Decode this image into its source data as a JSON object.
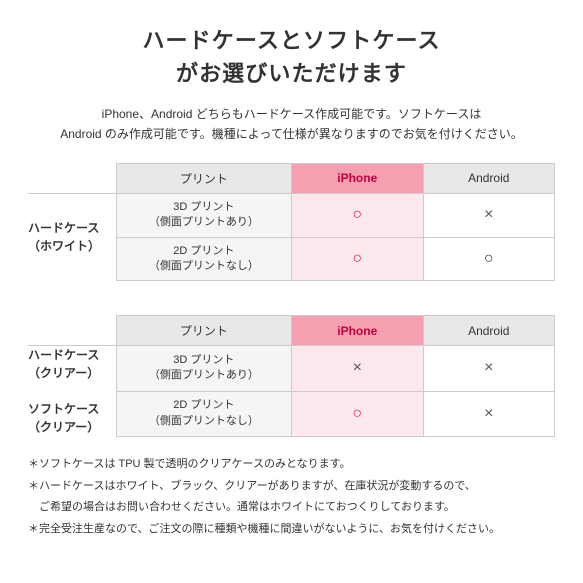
{
  "title": {
    "line1": "ハードケースとソフトケース",
    "line2": "がお選びいただけます"
  },
  "subtitle": "iPhone、Android どちらもハードケース作成可能です。ソフトケースは\nAndroid のみ作成可能です。機種によって仕様が異なりますのでお気を付けください。",
  "table1": {
    "left_label_line1": "ハードケース",
    "left_label_line2": "（ホワイト）",
    "header": {
      "col1": "プリント",
      "col2": "iPhone",
      "col3": "Android"
    },
    "rows": [
      {
        "label_line1": "3D プリント",
        "label_line2": "（側面プリントあり）",
        "iphone": "○",
        "android": "×"
      },
      {
        "label_line1": "2D プリント",
        "label_line2": "（側面プリントなし）",
        "iphone": "○",
        "android": "○"
      }
    ]
  },
  "table2": {
    "left_label_line1": "ハードケース",
    "left_label_line2": "（クリアー）",
    "left_label2_line1": "ソフトケース",
    "left_label2_line2": "（クリアー）",
    "header": {
      "col1": "プリント",
      "col2": "iPhone",
      "col3": "Android"
    },
    "rows": [
      {
        "label_line1": "3D プリント",
        "label_line2": "（側面プリントあり）",
        "iphone": "×",
        "android": "×"
      },
      {
        "label_line1": "2D プリント",
        "label_line2": "（側面プリントなし）",
        "iphone": "○",
        "android": "×"
      }
    ]
  },
  "notes": [
    "＊ソフトケースは TPU 製で透明のクリアケースのみとなります。",
    "＊ハードケースはホワイト、ブラック、クリアーがありますが、在庫状況が変動するので、",
    "　ご希望の場合はお問い合わせください。通常はホワイトにておつくりしております。",
    "＊完全受注生産なので、ご注文の際に種類や機種に間違いがないように、お気を付けください。"
  ]
}
